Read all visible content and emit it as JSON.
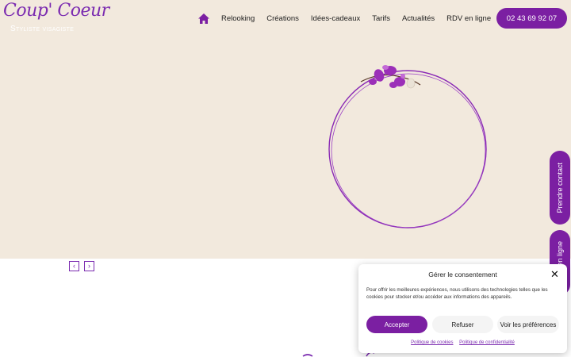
{
  "brand": {
    "name": "Coup' Coeur",
    "tagline": "Styliste visagiste"
  },
  "nav": {
    "items": [
      "Relooking",
      "Créations",
      "Idées-cadeaux",
      "Tarifs",
      "Actualités",
      "RDV en ligne"
    ]
  },
  "header": {
    "phone": "02 43 69 92 07"
  },
  "slider": {
    "prev": "‹",
    "next": "›"
  },
  "side_tabs": {
    "contact": "Prendre contact",
    "online": "RDV en ligne"
  },
  "consent": {
    "title": "Gérer le consentement",
    "close": "✕",
    "text": "Pour offrir les meilleures expériences, nous utilisons des technologies telles que les cookies pour stocker et/ou accéder aux informations des appareils.",
    "accept": "Accepter",
    "refuse": "Refuser",
    "preferences": "Voir les préférences",
    "cookie_policy": "Politique de cookies",
    "privacy_policy": "Politique de confidentialité"
  },
  "colors": {
    "accent": "#7b1fa2",
    "background": "#f2e9dd",
    "orchid": "#9b2fb8"
  },
  "icons": {
    "home": "home-icon",
    "close": "close-icon",
    "prev": "chevron-left-icon",
    "next": "chevron-right-icon"
  }
}
